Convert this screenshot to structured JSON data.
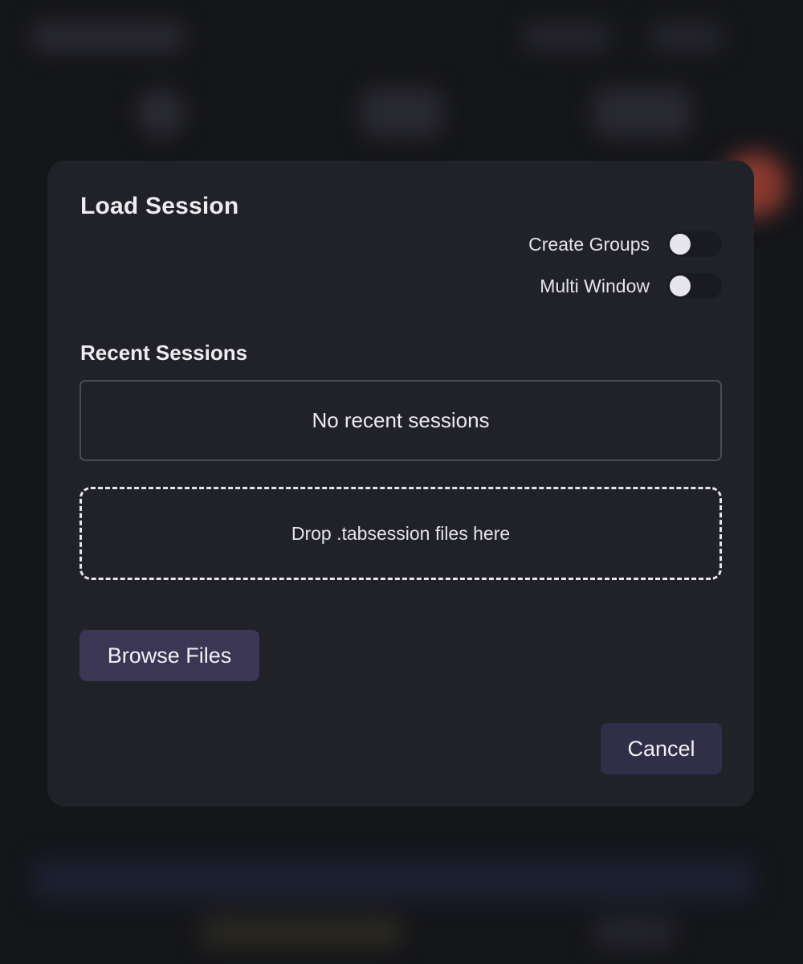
{
  "dialog": {
    "title": "Load Session",
    "options": {
      "create_groups": {
        "label": "Create Groups",
        "enabled": false
      },
      "multi_window": {
        "label": "Multi Window",
        "enabled": false
      }
    },
    "recent": {
      "heading": "Recent Sessions",
      "empty_text": "No recent sessions"
    },
    "drop_zone": {
      "text": "Drop .tabsession files here"
    },
    "buttons": {
      "browse_label": "Browse Files",
      "cancel_label": "Cancel"
    }
  },
  "colors": {
    "dialog_bg": "#212228",
    "button_bg": "#3a3653",
    "text": "#ececf1"
  }
}
